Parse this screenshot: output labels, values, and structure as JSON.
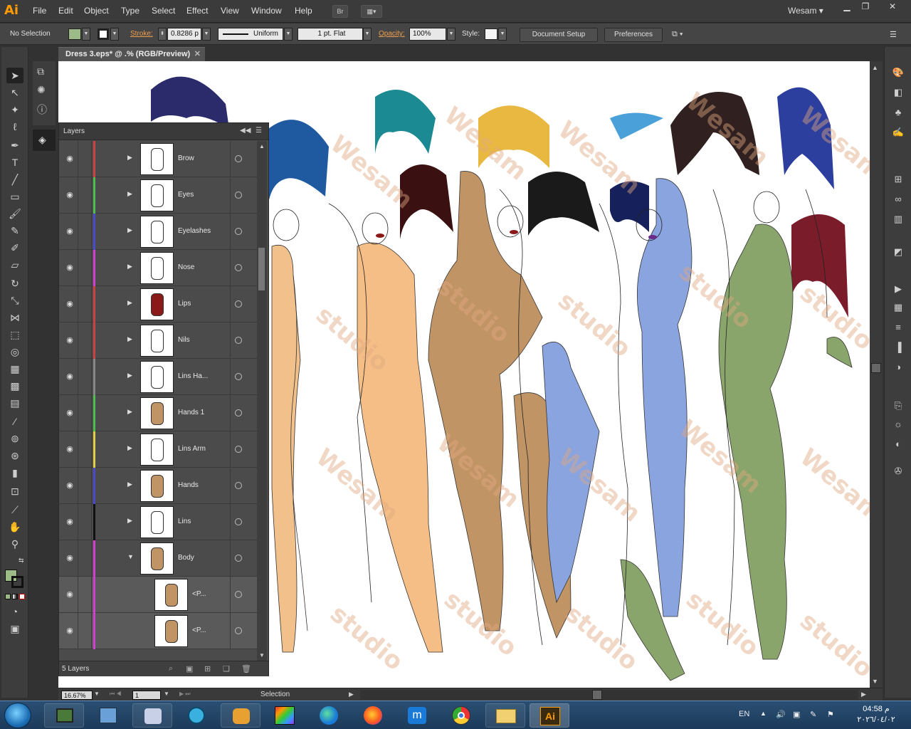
{
  "menubar": {
    "logo": "Ai",
    "items": [
      "File",
      "Edit",
      "Object",
      "Type",
      "Select",
      "Effect",
      "View",
      "Window",
      "Help"
    ],
    "bridge_button": "Br",
    "user": "Wesam"
  },
  "controlbar": {
    "selection_status": "No Selection",
    "stroke_label": "Stroke:",
    "stroke_weight": "0.8286 p",
    "stroke_profile": "Uniform",
    "brush": "1 pt. Flat",
    "opacity_label": "Opacity:",
    "opacity_value": "100%",
    "style_label": "Style:",
    "document_setup": "Document Setup",
    "preferences": "Preferences",
    "fill_color": "#9dbb86"
  },
  "document": {
    "tab_title": "Dress 3.eps* @ .% (RGB/Preview)",
    "watermark": "Wesam studio"
  },
  "layers_panel": {
    "title": "Layers",
    "count_label": "5 Layers",
    "rows": [
      {
        "name": "Brow",
        "color": "#d04040",
        "expanded": false
      },
      {
        "name": "Eyes",
        "color": "#4cc04c",
        "expanded": false
      },
      {
        "name": "Eyelashes",
        "color": "#4a4ad0",
        "expanded": false
      },
      {
        "name": "Nose",
        "color": "#d040d0",
        "expanded": false
      },
      {
        "name": "Lips",
        "color": "#d04040",
        "expanded": false
      },
      {
        "name": "Nils",
        "color": "#d04040",
        "expanded": false
      },
      {
        "name": "Lins Ha...",
        "color": "#888888",
        "expanded": false
      },
      {
        "name": "Hands 1",
        "color": "#4cc04c",
        "expanded": false
      },
      {
        "name": "Lins Arm",
        "color": "#e0d040",
        "expanded": false
      },
      {
        "name": "Hands",
        "color": "#4a4ad0",
        "expanded": false
      },
      {
        "name": "Lins",
        "color": "#111111",
        "expanded": false
      },
      {
        "name": "Body",
        "color": "#d040d0",
        "expanded": true
      },
      {
        "name": "<P...",
        "color": "#d040d0",
        "sublayer": true
      },
      {
        "name": "<P...",
        "color": "#d040d0",
        "sublayer": true
      }
    ]
  },
  "statusbar": {
    "zoom": "16.67%",
    "artboard": "1",
    "tool": "Selection"
  },
  "taskbar": {
    "language": "EN",
    "time": "04:58 م",
    "date": "٢٠٢٦/٠٤/٠٢"
  }
}
